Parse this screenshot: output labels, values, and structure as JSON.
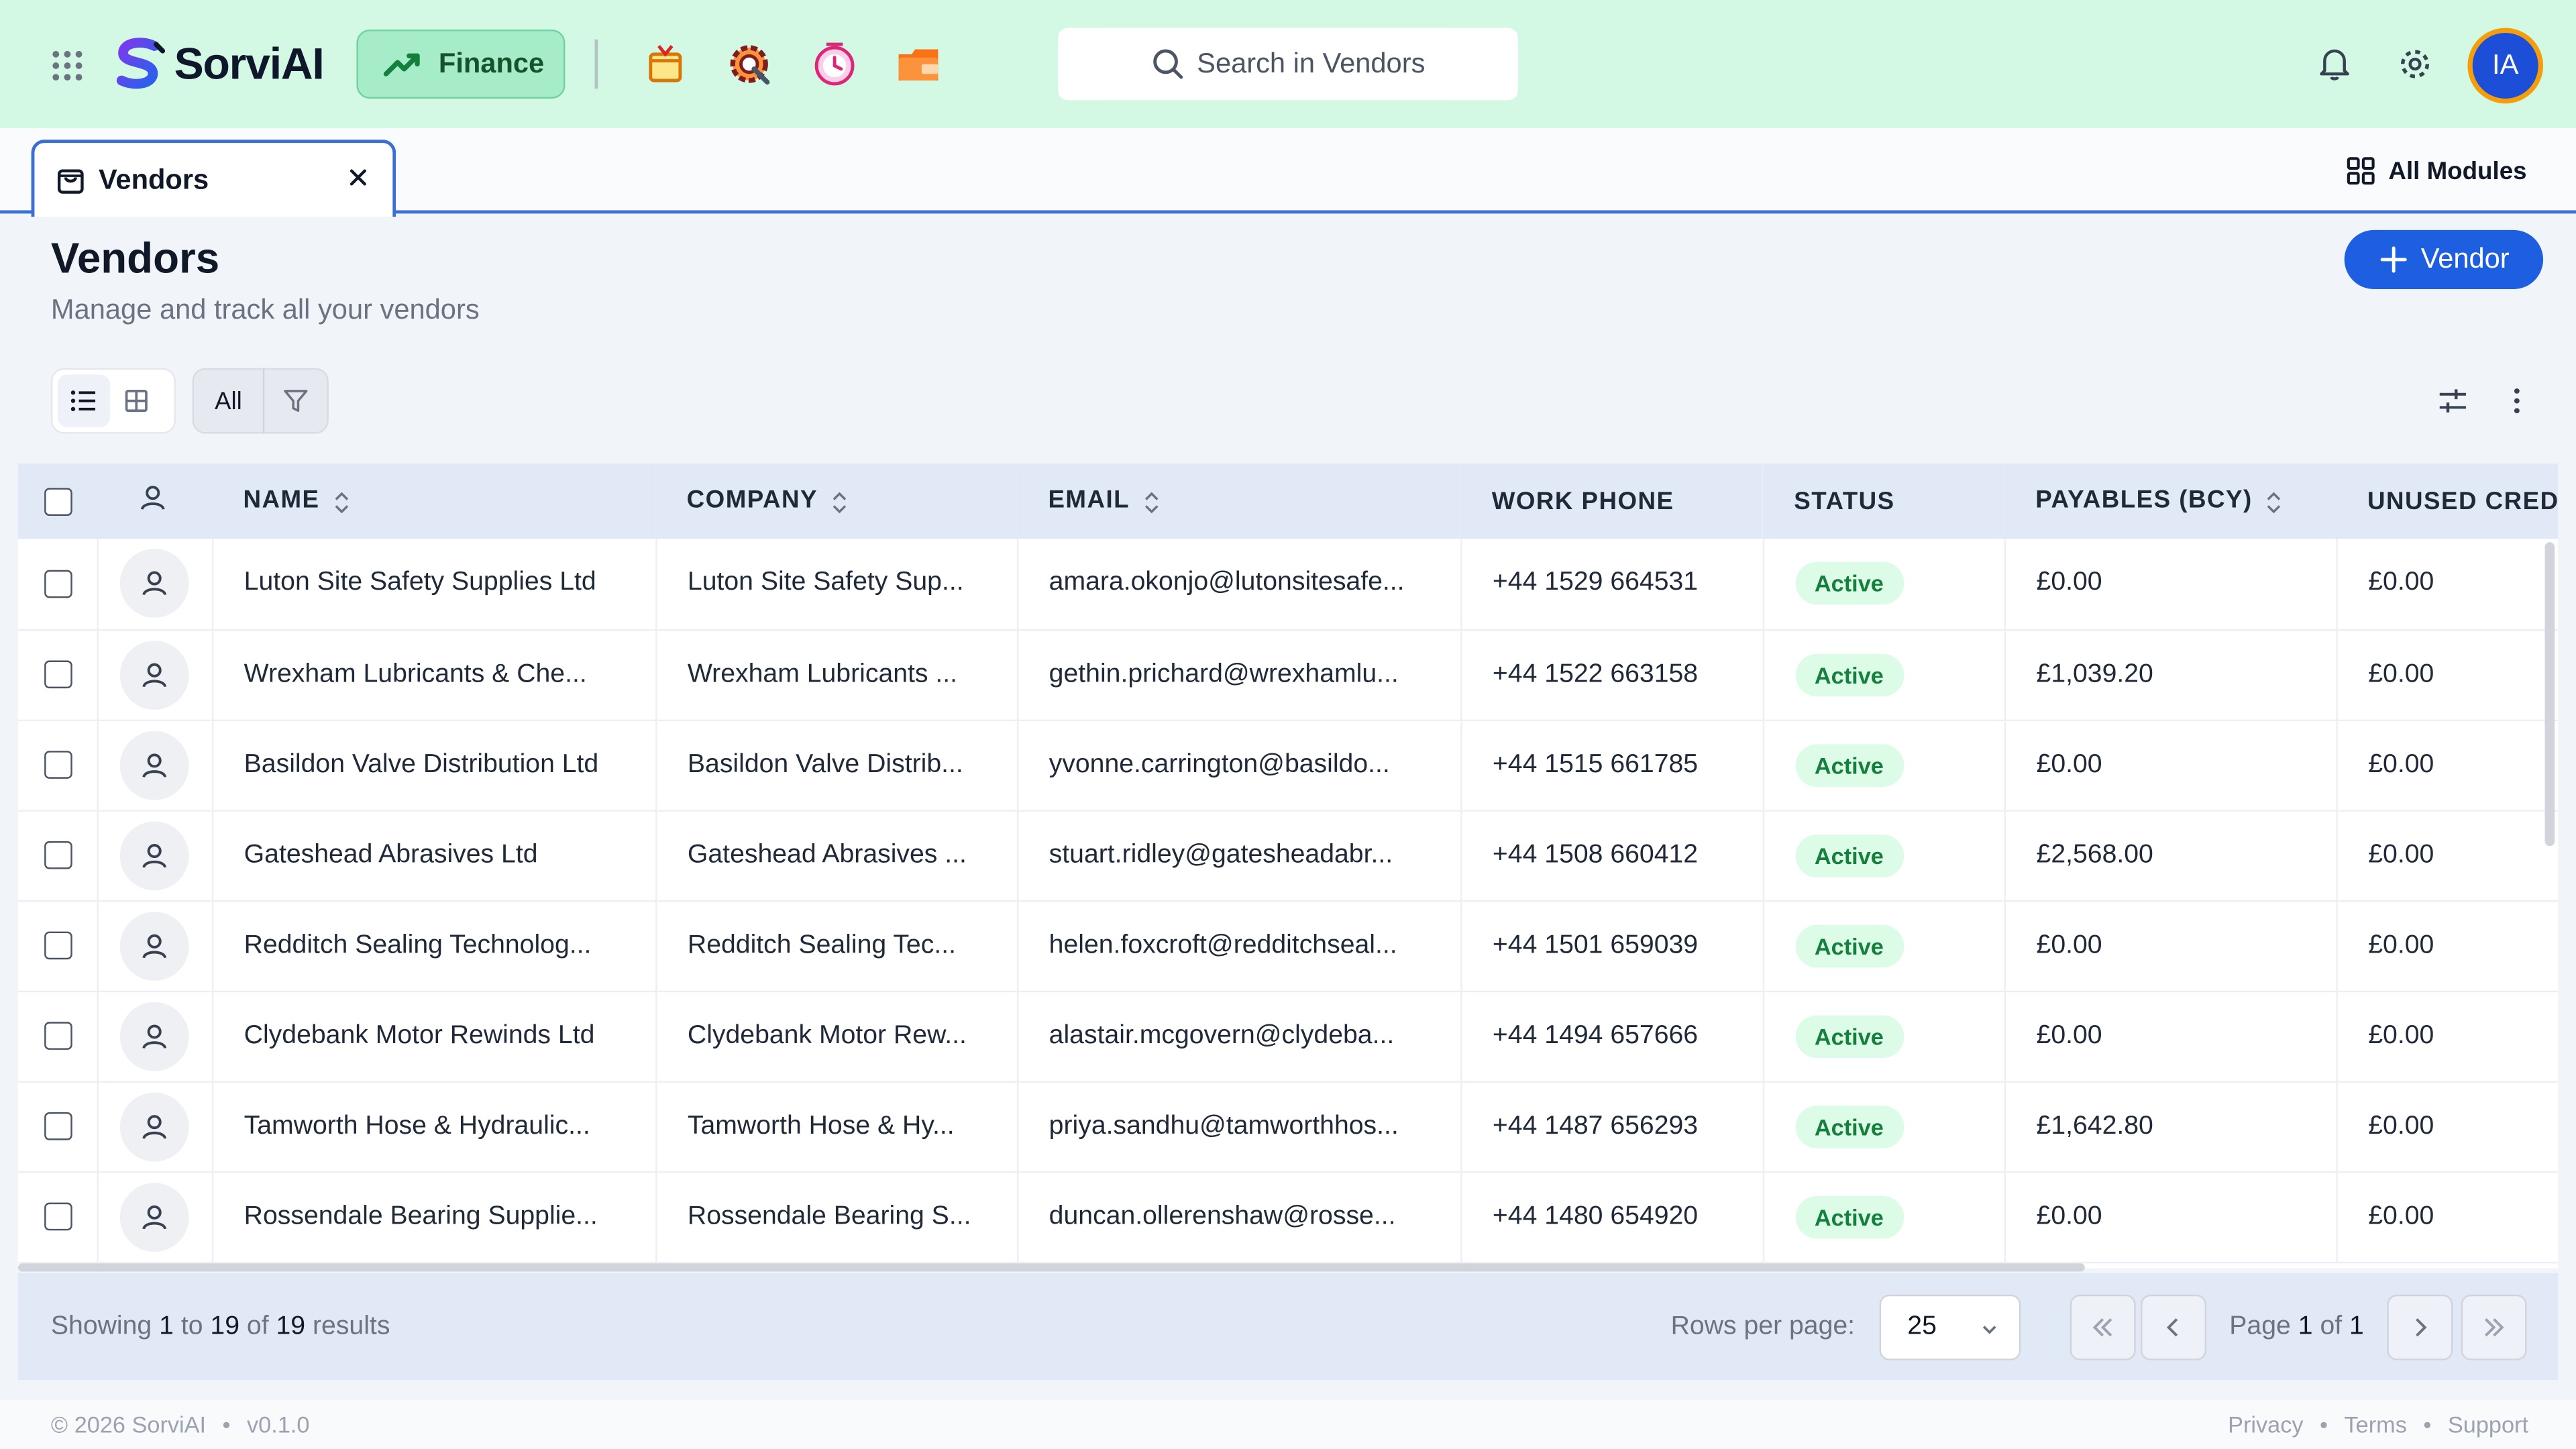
{
  "header": {
    "brand": "SorviAI",
    "module_button": "Finance",
    "search_placeholder": "Search in Vendors",
    "avatar_initials": "IA"
  },
  "tabs": [
    {
      "label": "Vendors"
    }
  ],
  "all_modules_label": "All Modules",
  "page": {
    "title": "Vendors",
    "subtitle": "Manage and track all your vendors",
    "add_button": "Vendor",
    "filter_label": "All"
  },
  "table": {
    "columns": [
      "NAME",
      "COMPANY",
      "EMAIL",
      "WORK PHONE",
      "STATUS",
      "PAYABLES (BCY)",
      "UNUSED CREDI"
    ],
    "rows": [
      {
        "name": "Luton Site Safety Supplies Ltd",
        "company": "Luton Site Safety Sup...",
        "email": "amara.okonjo@lutonsitesafe...",
        "phone": "+44 1529 664531",
        "status": "Active",
        "payables": "£0.00",
        "credits": "£0.00"
      },
      {
        "name": "Wrexham Lubricants & Che...",
        "company": "Wrexham Lubricants ...",
        "email": "gethin.prichard@wrexhamlu...",
        "phone": "+44 1522 663158",
        "status": "Active",
        "payables": "£1,039.20",
        "credits": "£0.00"
      },
      {
        "name": "Basildon Valve Distribution Ltd",
        "company": "Basildon Valve Distrib...",
        "email": "yvonne.carrington@basildo...",
        "phone": "+44 1515 661785",
        "status": "Active",
        "payables": "£0.00",
        "credits": "£0.00"
      },
      {
        "name": "Gateshead Abrasives Ltd",
        "company": "Gateshead Abrasives ...",
        "email": "stuart.ridley@gatesheadabr...",
        "phone": "+44 1508 660412",
        "status": "Active",
        "payables": "£2,568.00",
        "credits": "£0.00"
      },
      {
        "name": "Redditch Sealing Technolog...",
        "company": "Redditch Sealing Tec...",
        "email": "helen.foxcroft@redditchseal...",
        "phone": "+44 1501 659039",
        "status": "Active",
        "payables": "£0.00",
        "credits": "£0.00"
      },
      {
        "name": "Clydebank Motor Rewinds Ltd",
        "company": "Clydebank Motor Rew...",
        "email": "alastair.mcgovern@clydeba...",
        "phone": "+44 1494 657666",
        "status": "Active",
        "payables": "£0.00",
        "credits": "£0.00"
      },
      {
        "name": "Tamworth Hose & Hydraulic...",
        "company": "Tamworth Hose & Hy...",
        "email": "priya.sandhu@tamworthhos...",
        "phone": "+44 1487 656293",
        "status": "Active",
        "payables": "£1,642.80",
        "credits": "£0.00"
      },
      {
        "name": "Rossendale Bearing Supplie...",
        "company": "Rossendale Bearing S...",
        "email": "duncan.ollerenshaw@rosse...",
        "phone": "+44 1480 654920",
        "status": "Active",
        "payables": "£0.00",
        "credits": "£0.00"
      }
    ]
  },
  "pagination": {
    "showing_prefix": "Showing",
    "from": "1",
    "to_word": "to",
    "to": "19",
    "of_word": "of",
    "total": "19",
    "results_word": "results",
    "rows_per_page_label": "Rows per page:",
    "rows_per_page": "25",
    "page_word": "Page",
    "current_page": "1",
    "page_of_word": "of",
    "total_pages": "1"
  },
  "footer": {
    "copyright": "© 2026 SorviAI",
    "version": "v0.1.0",
    "links": [
      "Privacy",
      "Terms",
      "Support"
    ]
  },
  "colors": {
    "header_bg": "#d3f8e4",
    "accent": "#1d5fe0",
    "status_active_bg": "#dcfce7",
    "status_active_text": "#15803d"
  },
  "icons": [
    "apps-grid-icon",
    "trend-up-icon",
    "box-app-icon",
    "gear-app-icon",
    "clock-app-icon",
    "folder-app-icon",
    "search-icon",
    "bell-icon",
    "settings-icon",
    "bag-icon",
    "close-icon",
    "grid-modules-icon",
    "plus-icon",
    "list-view-icon",
    "grid-view-icon",
    "filter-icon",
    "sliders-icon",
    "more-vertical-icon",
    "user-icon",
    "sort-icon",
    "chevron-down-icon",
    "chevrons-left-icon",
    "chevron-left-icon",
    "chevron-right-icon",
    "chevrons-right-icon"
  ]
}
